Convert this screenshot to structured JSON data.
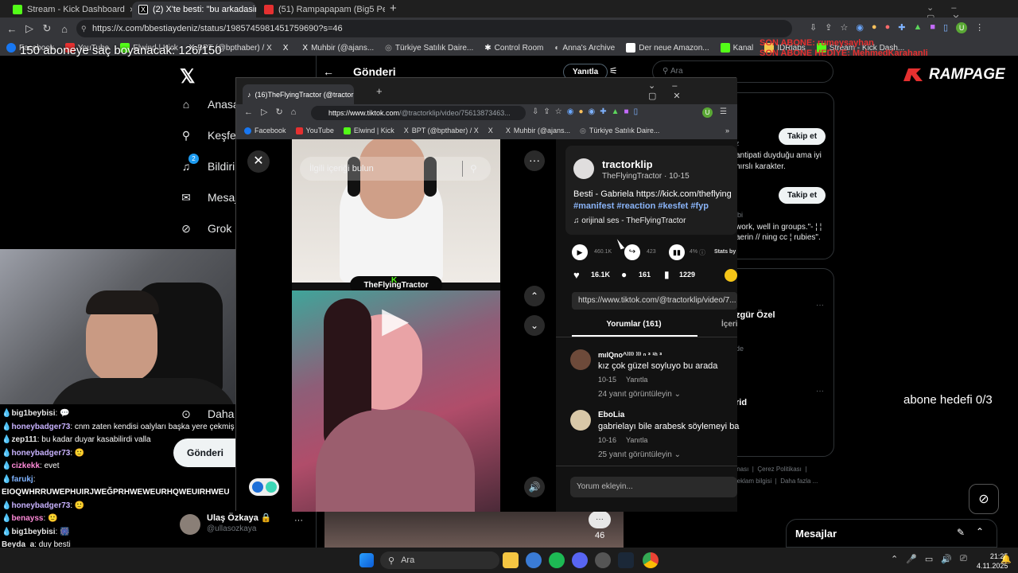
{
  "browser": {
    "tabs": [
      {
        "title": "Stream - Kick Dashboard",
        "color": "#53fc18"
      },
      {
        "title": "(2) X'te besti: \"bu arkadasin bir c",
        "color": "#ffffff"
      },
      {
        "title": "(51) Rampapapam (Big5 Performa",
        "color": "#e53030"
      }
    ],
    "new_tab": "+",
    "url": "https://x.com/bbestiaydeniz/status/1985745981451759690?s=46",
    "bookmarks": [
      "Facebook",
      "YouTube",
      "Elwind | Kick",
      "BPT (@bpthaber) / X",
      "",
      "Muhbir (@ajans...",
      "Türkiye Satılık Daire...",
      "Control Room",
      "Anna's Archive",
      "Der neue Amazon...",
      "Kanal",
      "IDRlabs",
      "Stream - Kick Dash..."
    ]
  },
  "overlay": {
    "goal_text": "150 aboneye saç boyanacak: 126/150",
    "alert_line1": "SON ABONE: rumeysayhan",
    "alert_line2": "SON ABONE HEDİYE: MehmedKarahanli",
    "brand": "RAMPAGE",
    "abone_hedefi": "abone hedefi 0/3"
  },
  "x": {
    "header": "Gönderi",
    "reply_button": "Yanıtla",
    "search_placeholder": "Ara",
    "nav": [
      {
        "label": "Anasayfa",
        "icon": "home-icon"
      },
      {
        "label": "Keşfet",
        "icon": "search-icon"
      },
      {
        "label": "Bildirimler",
        "icon": "bell-icon",
        "badge": "2"
      },
      {
        "label": "Mesajlar",
        "icon": "mail-icon"
      },
      {
        "label": "Grok",
        "icon": "grok-icon"
      },
      {
        "label": "Daha fazla",
        "icon": "more-icon"
      }
    ],
    "post_button": "Gönderi",
    "profile_name": "Ulaş Özkaya 🔒",
    "profile_handle": "@ullasozkaya",
    "follow_label": "Takip et",
    "suggest1": "antipati duyduğu ama iyi\nhırslı karakter.",
    "suggest1_top": "z",
    "suggest2_top": "ibi",
    "suggest2": "work, well in groups.\"- ¦ ¦\naerin // ning cc ¦ rubies\".",
    "trend1": "zgür Özel",
    "trend1_meta": "de",
    "trend2": "rid",
    "footer_links": "ınası  |  Çerez Politikası  |\nreklam bilgisi  |  Daha fazla ...",
    "comment_count": "46",
    "messages_label": "Mesajlar",
    "dots": "···"
  },
  "chat": [
    {
      "user": "big1beybisi",
      "color": "#e7e7e7",
      "text": ": 💬"
    },
    {
      "user": "honeybadger73",
      "color": "#c9b3ff",
      "text": ": cnm zaten kendisi oalyları başka yere çekmiş"
    },
    {
      "user": "zep111",
      "color": "#e7e7e7",
      "text": ": bu kadar duyar kasabilirdi valla"
    },
    {
      "user": "honeybadger73",
      "color": "#c9b3ff",
      "text": ": 🙂"
    },
    {
      "user": "cizkekk",
      "color": "#ff8ad8",
      "text": ": evet"
    },
    {
      "user": "farukj",
      "color": "#7fb3ff",
      "text": ":"
    },
    {
      "user": "",
      "color": "#e7e7e7",
      "text": "EIOQWHRRUWEPHUIRJWEĞPRHWEWEURHQWEUIRHWEU"
    },
    {
      "user": "honeybadger73",
      "color": "#c9b3ff",
      "text": ": 🙂"
    },
    {
      "user": "benayss",
      "color": "#ff8ad8",
      "text": ": 🙂"
    },
    {
      "user": "big1beybisi",
      "color": "#e7e7e7",
      "text": ": 🎆"
    },
    {
      "user": "Beyda_a",
      "color": "#e7e7e7",
      "text": ": duy besti"
    }
  ],
  "tiktok": {
    "tab_title": "(16)TheFlyingTractor (@tractorkli",
    "url_host": "https://www.tiktok.com",
    "url_path": "/@tractorklip/video/75613873463...",
    "bookmarks": [
      "Facebook",
      "YouTube",
      "Elwind | Kick",
      "BPT (@bpthaber) / X",
      "",
      "Muhbir (@ajans...",
      "Türkiye Satılık Daire..."
    ],
    "search_placeholder": "İlgili içeriği bulun",
    "watermark": "TheFlyingTractor",
    "author": "tractorklip",
    "author_sub": "TheFlyingTractor · 10-15",
    "caption": "Besti - Gabriela https://kick.com/theflying",
    "hashtags": "#manifest #reaction #kesfet #fyp",
    "sound": "orijinal ses - TheFlyingTractor",
    "plays": "460.1K",
    "shares": "423",
    "stats_pct": "4%",
    "stats_label": "Stats by",
    "likes": "16.1K",
    "comments": "161",
    "saves": "1229",
    "link": "https://www.tiktok.com/@tractorklip/video/7...",
    "tab_comments": "Yorumlar (161)",
    "tab_other": "İçeri",
    "comment_list": [
      {
        "user": "mılQno^⁾⁾⁾⁾ ⁾⁾⁾ ⁿ ³ ¹ʰ ³",
        "text": "kız çok güzel soyluyo bu arada",
        "date": "10-15",
        "reply": "Yanıtla",
        "more": "24 yanıt görüntüleyin ⌄"
      },
      {
        "user": "EboLia",
        "text": "gabrielayı bile arabesk söylemeyi ba",
        "date": "10-16",
        "reply": "Yanıtla",
        "more": "25 yanıt görüntüleyin ⌄"
      }
    ],
    "add_comment": "Yorum ekleyin..."
  },
  "taskbar": {
    "search": "Ara",
    "time": "21:25",
    "date": "4.11.2025"
  }
}
